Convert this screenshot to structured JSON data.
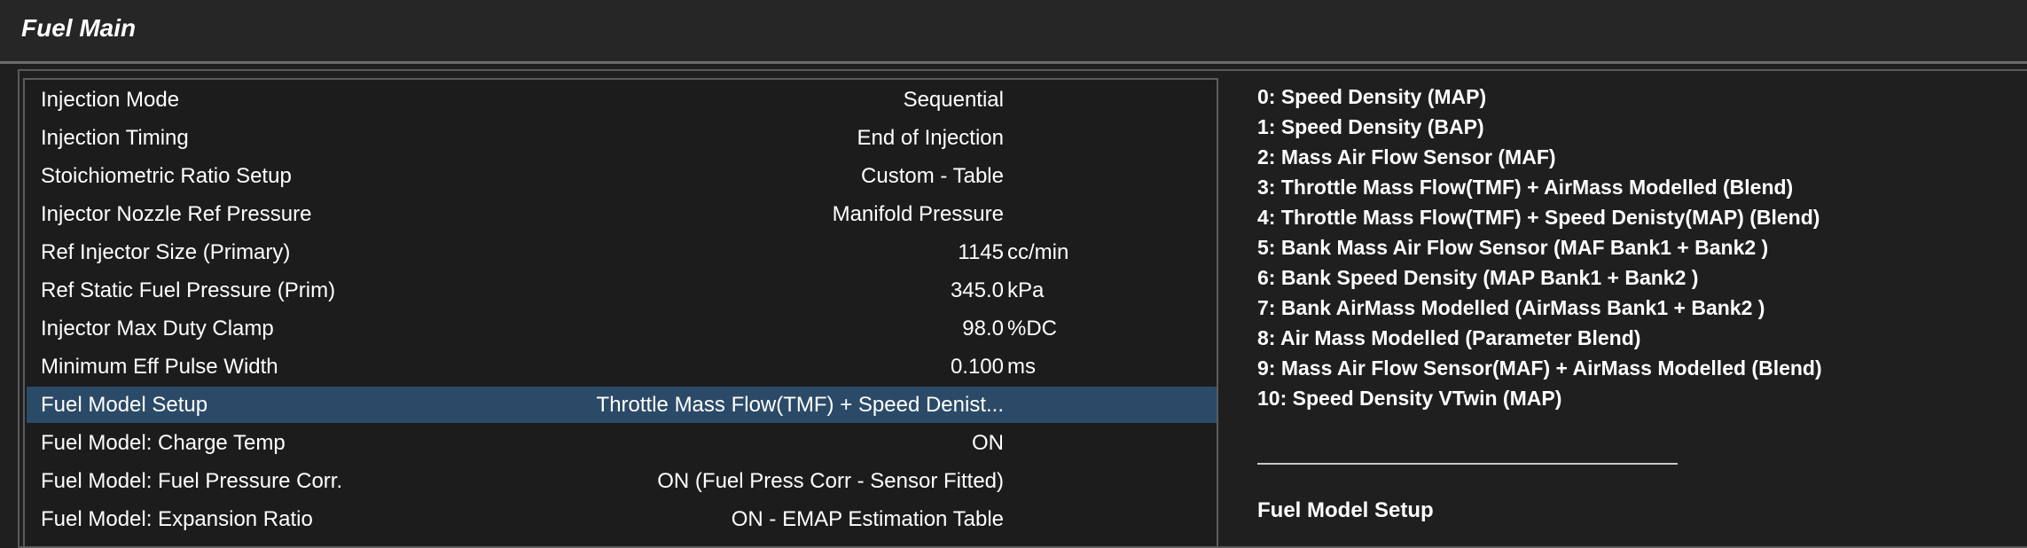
{
  "window": {
    "title": "Fuel Main"
  },
  "settings": [
    {
      "label": "Injection Mode",
      "value": "Sequential",
      "unit": ""
    },
    {
      "label": "Injection Timing",
      "value": "End of Injection",
      "unit": ""
    },
    {
      "label": "Stoichiometric Ratio Setup",
      "value": "Custom - Table",
      "unit": ""
    },
    {
      "label": "Injector Nozzle Ref Pressure",
      "value": "Manifold Pressure",
      "unit": ""
    },
    {
      "label": "Ref Injector Size (Primary)",
      "value": "1145",
      "unit": "cc/min"
    },
    {
      "label": "Ref Static Fuel Pressure (Prim)",
      "value": "345.0",
      "unit": "kPa"
    },
    {
      "label": "Injector Max Duty Clamp",
      "value": "98.0",
      "unit": "%DC"
    },
    {
      "label": "Minimum Eff Pulse Width",
      "value": "0.100",
      "unit": "ms"
    },
    {
      "label": "Fuel Model Setup",
      "value": "Throttle Mass Flow(TMF) + Speed Denist...",
      "unit": "",
      "selected": true
    },
    {
      "label": "Fuel Model: Charge Temp",
      "value": "ON",
      "unit": ""
    },
    {
      "label": "Fuel Model: Fuel Pressure Corr.",
      "value": "ON (Fuel Press Corr - Sensor Fitted)",
      "unit": ""
    },
    {
      "label": "Fuel Model: Expansion Ratio",
      "value": "ON - EMAP Estimation Table",
      "unit": ""
    }
  ],
  "help": {
    "options": [
      "0: Speed Density (MAP)",
      "1: Speed Density (BAP)",
      "2: Mass Air Flow Sensor (MAF)",
      "3: Throttle Mass Flow(TMF) + AirMass Modelled  (Blend)",
      "4: Throttle Mass Flow(TMF) + Speed Denisty(MAP) (Blend)",
      "5: Bank Mass Air Flow Sensor (MAF Bank1 + Bank2 )",
      "6: Bank Speed Density (MAP Bank1 + Bank2 )",
      "7: Bank AirMass Modelled (AirMass Bank1 + Bank2 )",
      "8: Air Mass Modelled (Parameter Blend)",
      "9: Mass Air Flow Sensor(MAF) + AirMass Modelled (Blend)",
      "10: Speed Density VTwin (MAP)"
    ],
    "heading": "Fuel Model Setup"
  }
}
